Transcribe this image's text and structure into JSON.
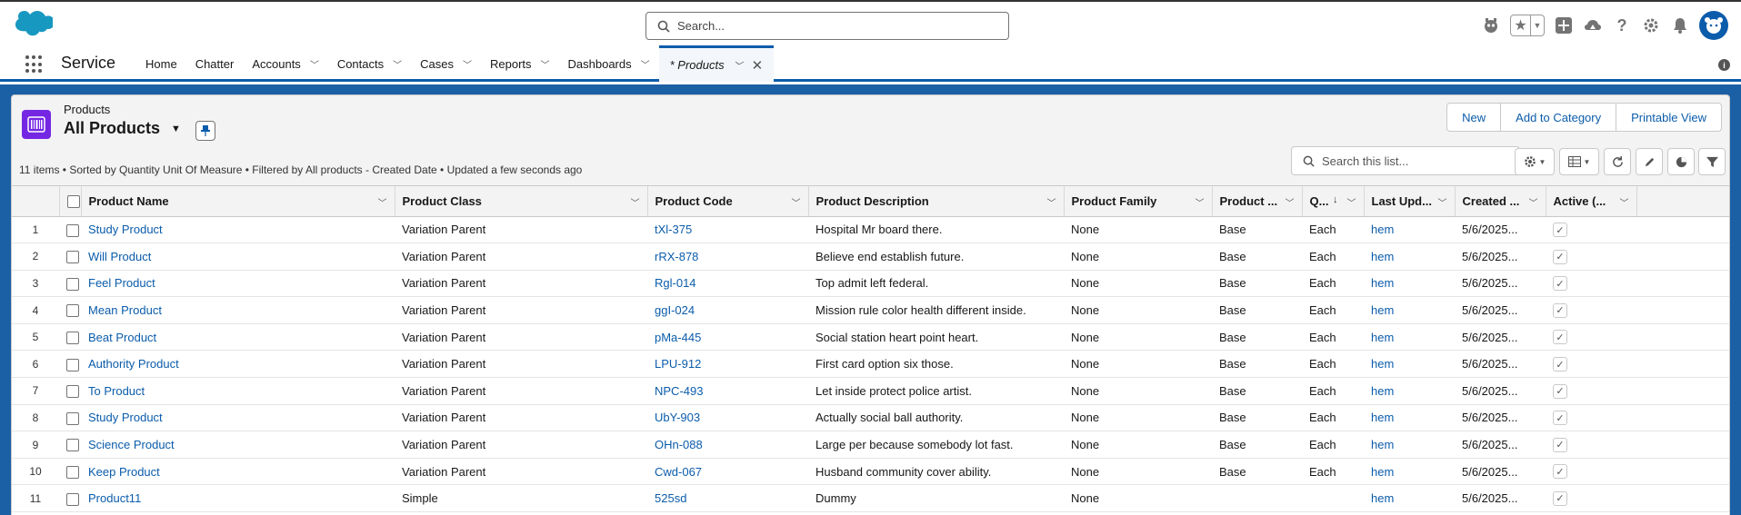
{
  "global_header": {
    "search_placeholder": "Search...",
    "icons": [
      "salesforce-cloud-logo",
      "search-icon",
      "einstein-icon",
      "star-icon",
      "chevron-down-icon",
      "add-icon",
      "trailhead-icon",
      "help-icon",
      "setup-gear-icon",
      "bell-icon",
      "avatar-icon"
    ]
  },
  "nav": {
    "app_name": "Service",
    "items": [
      {
        "label": "Home",
        "has_menu": false
      },
      {
        "label": "Chatter",
        "has_menu": false
      },
      {
        "label": "Accounts",
        "has_menu": true
      },
      {
        "label": "Contacts",
        "has_menu": true
      },
      {
        "label": "Cases",
        "has_menu": true
      },
      {
        "label": "Reports",
        "has_menu": true
      },
      {
        "label": "Dashboards",
        "has_menu": true
      }
    ],
    "active_tab": {
      "label": "* Products"
    }
  },
  "list_view": {
    "object_label": "Products",
    "title": "All Products",
    "subtitle": "11 items • Sorted by Quantity Unit Of Measure • Filtered by All products - Created Date • Updated a few seconds ago",
    "buttons": {
      "new": "New",
      "add_to_category": "Add to Category",
      "printable_view": "Printable View"
    },
    "search_placeholder": "Search this list..."
  },
  "table": {
    "columns": [
      "Product Name",
      "Product Class",
      "Product Code",
      "Product Description",
      "Product Family",
      "Product ...",
      "Q...",
      "Last Upd...",
      "Created ...",
      "Active (..."
    ],
    "rows": [
      {
        "n": "1",
        "name": "Study Product",
        "class": "Variation Parent",
        "code": "tXl-375",
        "desc": "Hospital Mr board there.",
        "family": "None",
        "type": "Base",
        "qty": "Each",
        "last": "hem",
        "created": "5/6/2025...",
        "active": true
      },
      {
        "n": "2",
        "name": "Will Product",
        "class": "Variation Parent",
        "code": "rRX-878",
        "desc": "Believe end establish future.",
        "family": "None",
        "type": "Base",
        "qty": "Each",
        "last": "hem",
        "created": "5/6/2025...",
        "active": true
      },
      {
        "n": "3",
        "name": "Feel Product",
        "class": "Variation Parent",
        "code": "Rgl-014",
        "desc": "Top admit left federal.",
        "family": "None",
        "type": "Base",
        "qty": "Each",
        "last": "hem",
        "created": "5/6/2025...",
        "active": true
      },
      {
        "n": "4",
        "name": "Mean Product",
        "class": "Variation Parent",
        "code": "ggI-024",
        "desc": "Mission rule color health different inside.",
        "family": "None",
        "type": "Base",
        "qty": "Each",
        "last": "hem",
        "created": "5/6/2025...",
        "active": true
      },
      {
        "n": "5",
        "name": "Beat Product",
        "class": "Variation Parent",
        "code": "pMa-445",
        "desc": "Social station heart point heart.",
        "family": "None",
        "type": "Base",
        "qty": "Each",
        "last": "hem",
        "created": "5/6/2025...",
        "active": true
      },
      {
        "n": "6",
        "name": "Authority Product",
        "class": "Variation Parent",
        "code": "LPU-912",
        "desc": "First card option six those.",
        "family": "None",
        "type": "Base",
        "qty": "Each",
        "last": "hem",
        "created": "5/6/2025...",
        "active": true
      },
      {
        "n": "7",
        "name": "To Product",
        "class": "Variation Parent",
        "code": "NPC-493",
        "desc": "Let inside protect police artist.",
        "family": "None",
        "type": "Base",
        "qty": "Each",
        "last": "hem",
        "created": "5/6/2025...",
        "active": true
      },
      {
        "n": "8",
        "name": "Study Product",
        "class": "Variation Parent",
        "code": "UbY-903",
        "desc": "Actually social ball authority.",
        "family": "None",
        "type": "Base",
        "qty": "Each",
        "last": "hem",
        "created": "5/6/2025...",
        "active": true
      },
      {
        "n": "9",
        "name": "Science Product",
        "class": "Variation Parent",
        "code": "OHn-088",
        "desc": "Large per because somebody lot fast.",
        "family": "None",
        "type": "Base",
        "qty": "Each",
        "last": "hem",
        "created": "5/6/2025...",
        "active": true
      },
      {
        "n": "10",
        "name": "Keep Product",
        "class": "Variation Parent",
        "code": "Cwd-067",
        "desc": "Husband community cover ability.",
        "family": "None",
        "type": "Base",
        "qty": "Each",
        "last": "hem",
        "created": "5/6/2025...",
        "active": true
      },
      {
        "n": "11",
        "name": "Product11",
        "class": "Simple",
        "code": "525sd",
        "desc": "Dummy",
        "family": "None",
        "type": "",
        "qty": "",
        "last": "hem",
        "created": "5/6/2025...",
        "active": true
      }
    ]
  },
  "colors": {
    "brand_blue": "#0b5cab",
    "band_blue": "#1b5fa5",
    "object_icon": "#7526e3"
  }
}
